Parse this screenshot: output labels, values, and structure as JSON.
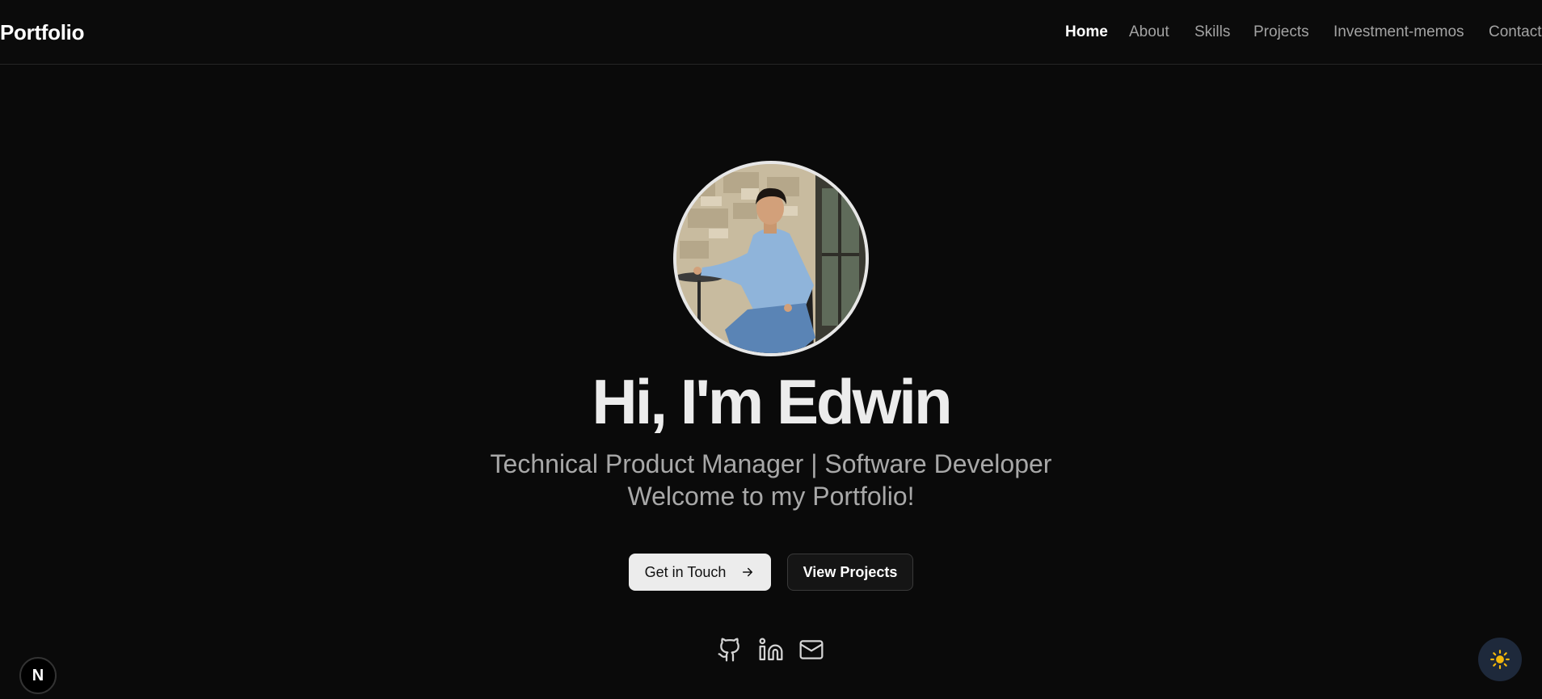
{
  "header": {
    "logo": "Portfolio",
    "nav": [
      {
        "label": "Home",
        "active": true
      },
      {
        "label": "About",
        "active": false
      },
      {
        "label": "Skills",
        "active": false
      },
      {
        "label": "Projects",
        "active": false
      },
      {
        "label": "Investment-memos",
        "active": false
      },
      {
        "label": "Contact",
        "active": false
      }
    ]
  },
  "hero": {
    "title": "Hi, I'm Edwin",
    "subtitle_line1": "Technical Product Manager | Software Developer",
    "subtitle_line2": "Welcome to my Portfolio!",
    "primary_button": "Get in Touch",
    "primary_button_icon": "arrow-right-icon",
    "secondary_button": "View Projects",
    "socials": [
      "github-icon",
      "linkedin-icon",
      "mail-icon"
    ]
  },
  "corner": {
    "next_badge": "N",
    "theme_toggle_icon": "sun-icon"
  },
  "colors": {
    "background": "#0a0a0a",
    "primary_button_bg": "#ececec",
    "theme_toggle_bg": "#1e293b",
    "sun": "#f5b80b"
  }
}
